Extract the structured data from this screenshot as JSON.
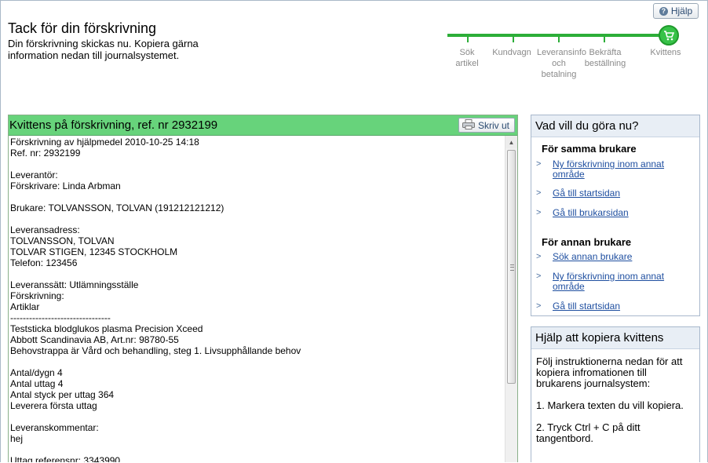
{
  "header": {
    "title": "Tack för din förskrivning",
    "subtitle": "Din förskrivning skickas nu. Kopiera gärna information nedan till journalsystemet.",
    "help_label": "Hjälp",
    "help_glyph": "?"
  },
  "progress": {
    "steps": [
      {
        "label": "Sök artikel"
      },
      {
        "label": "Kundvagn"
      },
      {
        "label": "Leveransinfo och betalning"
      },
      {
        "label": "Bekräfta beställning"
      },
      {
        "label": "Kvittens"
      }
    ],
    "current_step": 5,
    "accent_color": "#2cae38"
  },
  "receipt": {
    "title": "Kvittens på förskrivning, ref. nr 2932199",
    "print_label": "Skriv ut",
    "lines": [
      "Förskrivning av hjälpmedel 2010-10-25 14:18",
      "Ref. nr: 2932199",
      "",
      "Leverantör:",
      "Förskrivare: Linda Arbman",
      "",
      "Brukare: TOLVANSSON, TOLVAN (191212121212)",
      "",
      "Leveransadress:",
      "TOLVANSSON, TOLVAN",
      "TOLVAR STIGEN, 12345 STOCKHOLM",
      "Telefon: 123456",
      "",
      "Leveranssätt: Utlämningsställe",
      "Förskrivning:",
      "Artiklar",
      "--------------------------------",
      "Teststicka blodglukos plasma Precision Xceed",
      "Abbott Scandinavia AB, Art.nr: 98780-55",
      "Behovstrappa är Vård och behandling, steg 1. Livsupphållande behov",
      "",
      "Antal/dygn 4",
      "Antal uttag 4",
      "Antal styck per uttag 364",
      "Leverera första uttag",
      "",
      "Leveranskommentar:",
      "hej",
      "",
      "Uttag referensnr: 3343990"
    ],
    "header_color": "#67d37b"
  },
  "actions": {
    "title": "Vad vill du göra nu?",
    "same_user": {
      "heading": "För samma brukare",
      "links": [
        "Ny förskrivning inom annat område",
        "Gå till startsidan",
        "Gå till brukarsidan"
      ]
    },
    "other_user": {
      "heading": "För annan brukare",
      "links": [
        "Sök annan brukare",
        "Ny förskrivning inom annat område",
        "Gå till startsidan"
      ]
    },
    "arrow_glyph": ">"
  },
  "copy_help": {
    "title": "Hjälp att kopiera kvittens",
    "paragraphs": [
      "Följ instruktionerna nedan för att kopiera infromationen till brukarens journalsystem:",
      "1. Markera texten du vill kopiera.",
      "2. Tryck Ctrl + C på ditt tangentbord."
    ]
  }
}
